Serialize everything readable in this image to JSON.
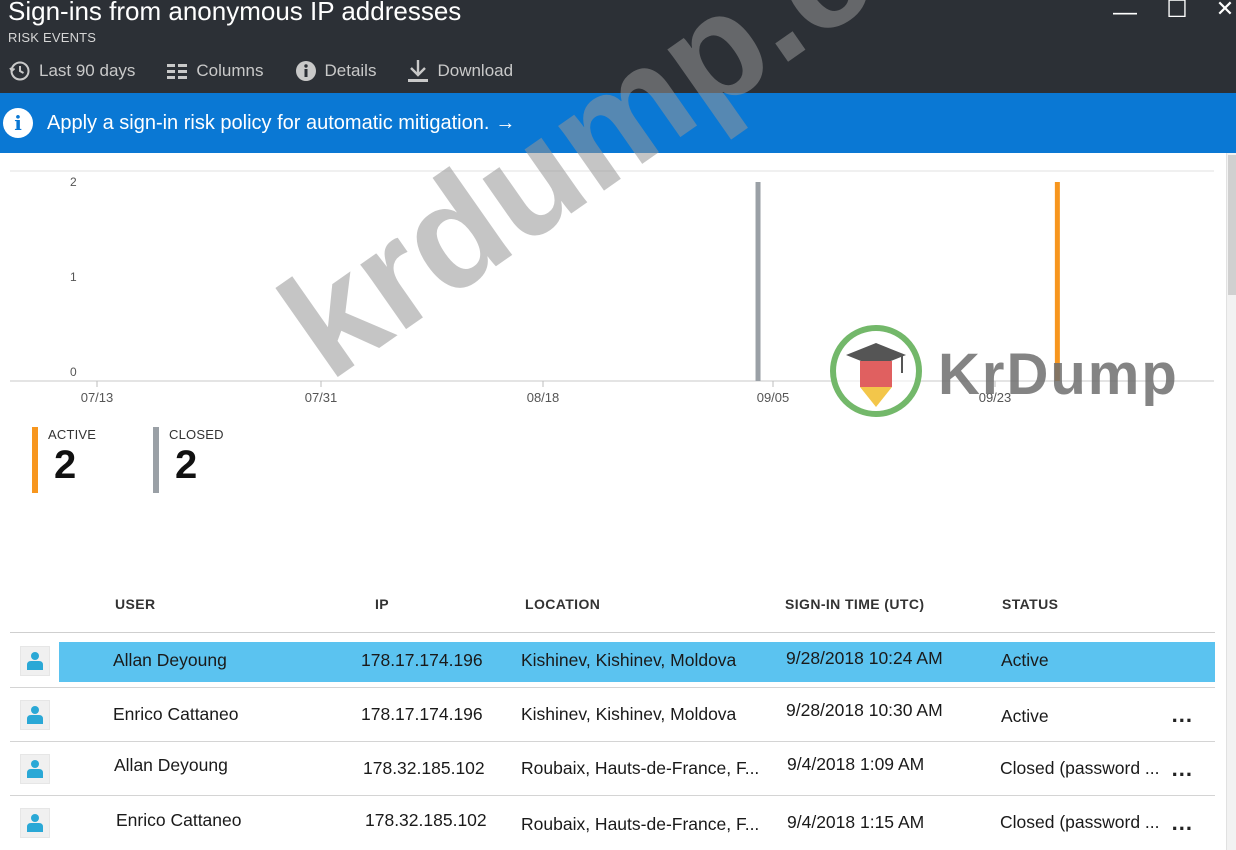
{
  "window": {
    "title": "Sign-ins from anonymous IP addresses",
    "subtitle": "RISK EVENTS",
    "minimize_glyph": "—",
    "maximize_glyph": "☐",
    "close_glyph": "✕"
  },
  "toolbar": {
    "last90_label": "Last 90 days",
    "columns_label": "Columns",
    "details_label": "Details",
    "download_label": "Download",
    "icons": [
      "history-icon",
      "columns-icon",
      "info-icon",
      "download-icon"
    ]
  },
  "banner": {
    "text": "Apply a sign-in risk policy for automatic mitigation.",
    "arrow": "→",
    "info_glyph": "i",
    "color": "#0a78d4"
  },
  "chart_data": {
    "type": "bar",
    "y_ticks": [
      "0",
      "1",
      "2"
    ],
    "x_ticks": [
      "07/13",
      "07/31",
      "08/18",
      "09/05",
      "09/23"
    ],
    "ylim": [
      0,
      2
    ],
    "series": [
      {
        "name": "CLOSED",
        "color": "#9aa0a6",
        "x": "09/04",
        "values": [
          2
        ]
      },
      {
        "name": "ACTIVE",
        "color": "#f7961e",
        "x": "09/28",
        "values": [
          2
        ]
      }
    ]
  },
  "counters": {
    "active": {
      "label": "ACTIVE",
      "value": "2",
      "color": "#f7961e"
    },
    "closed": {
      "label": "CLOSED",
      "value": "2",
      "color": "#9aa0a6"
    }
  },
  "table": {
    "columns": [
      "USER",
      "IP",
      "LOCATION",
      "SIGN-IN TIME (UTC)",
      "STATUS"
    ],
    "rows": [
      {
        "user": "Allan Deyoung",
        "ip": "178.17.174.196",
        "location": "Kishinev, Kishinev, Moldova",
        "time": "9/28/2018 10:24 AM",
        "status": "Active",
        "more": ""
      },
      {
        "user": "Enrico Cattaneo",
        "ip": "178.17.174.196",
        "location": "Kishinev, Kishinev, Moldova",
        "time": "9/28/2018 10:30 AM",
        "status": "Active",
        "more": "..."
      },
      {
        "user": "Allan Deyoung",
        "ip": "178.32.185.102",
        "location": "Roubaix, Hauts-de-France, F...",
        "time": "9/4/2018 1:09 AM",
        "status": "Closed (password ...",
        "more": "..."
      },
      {
        "user": "Enrico Cattaneo",
        "ip": "178.32.185.102",
        "location": "Roubaix, Hauts-de-France, F...",
        "time": "9/4/2018 1:15 AM",
        "status": "Closed (password ...",
        "more": "..."
      }
    ]
  },
  "watermark": {
    "big_text": "krdump.com",
    "logo_text": "KrDump"
  }
}
